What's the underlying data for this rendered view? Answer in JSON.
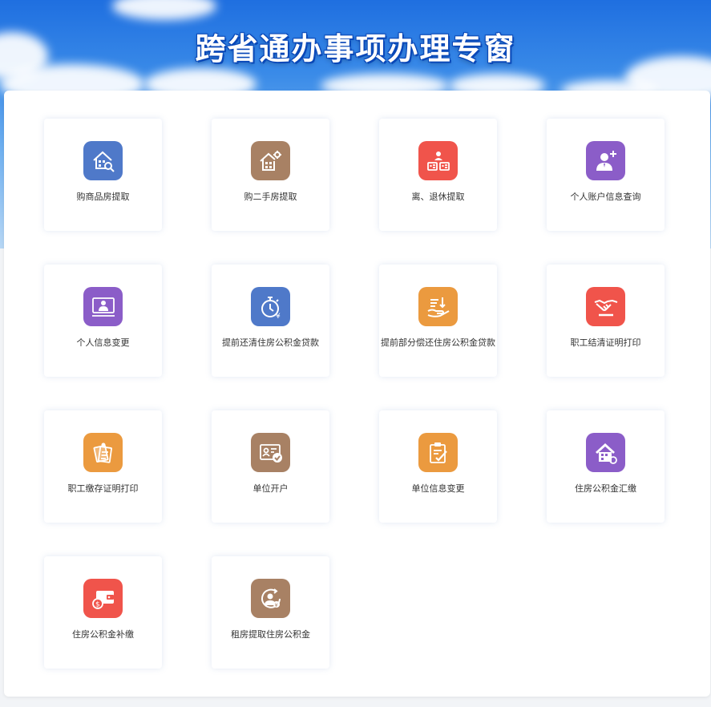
{
  "banner": {
    "title": "跨省通办事项办理专窗"
  },
  "colors": {
    "blue": "#4f79c9",
    "brown": "#a88164",
    "red": "#f0544b",
    "purple": "#8b5dc8",
    "orange": "#eb9a3f"
  },
  "items": [
    {
      "label": "购商品房提取",
      "icon": "house-search-icon",
      "color": "#4f79c9"
    },
    {
      "label": "购二手房提取",
      "icon": "house-gear-icon",
      "color": "#a88164"
    },
    {
      "label": "离、退休提取",
      "icon": "retirement-cards-icon",
      "color": "#f0544b"
    },
    {
      "label": "个人账户信息查询",
      "icon": "user-add-icon",
      "color": "#8b5dc8"
    },
    {
      "label": "个人信息变更",
      "icon": "user-monitor-icon",
      "color": "#8b5dc8"
    },
    {
      "label": "提前还清住房公积金贷款",
      "icon": "stopwatch-yuan-icon",
      "color": "#4f79c9"
    },
    {
      "label": "提前部分偿还住房公积金贷款",
      "icon": "hand-payment-icon",
      "color": "#eb9a3f"
    },
    {
      "label": "职工结清证明打印",
      "icon": "handshake-icon",
      "color": "#f0544b"
    },
    {
      "label": "职工缴存证明打印",
      "icon": "documents-icon",
      "color": "#eb9a3f"
    },
    {
      "label": "单位开户",
      "icon": "id-card-check-icon",
      "color": "#a88164"
    },
    {
      "label": "单位信息变更",
      "icon": "clipboard-check-icon",
      "color": "#eb9a3f"
    },
    {
      "label": "住房公积金汇缴",
      "icon": "house-coin-icon",
      "color": "#8b5dc8"
    },
    {
      "label": "住房公积金补缴",
      "icon": "wallet-icon",
      "color": "#f0544b"
    },
    {
      "label": "租房提取住房公积金",
      "icon": "user-circle-yuan-icon",
      "color": "#a88164"
    }
  ]
}
